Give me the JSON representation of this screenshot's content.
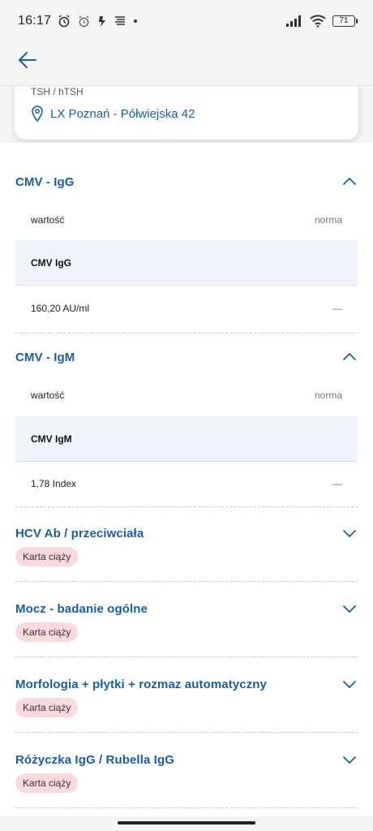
{
  "status_bar": {
    "time": "16:17",
    "battery": "71"
  },
  "card": {
    "test_name": "TSH / hTSH",
    "location": "LX Poznań - Półwiejska 42"
  },
  "sections": [
    {
      "title": "CMV - IgG",
      "header_left": "wartość",
      "header_right": "norma",
      "param": "CMV IgG",
      "value": "160,20 AU/ml",
      "norm": "—"
    },
    {
      "title": "CMV - IgM",
      "header_left": "wartość",
      "header_right": "norma",
      "param": "CMV IgM",
      "value": "1,78 Index",
      "norm": "—"
    }
  ],
  "collapsed": [
    {
      "title": "HCV Ab / przeciwciała",
      "badge": "Karta ciąży"
    },
    {
      "title": "Mocz - badanie ogólne",
      "badge": "Karta ciąży"
    },
    {
      "title": "Morfologia + płytki + rozmaz automatyczny",
      "badge": "Karta ciąży"
    },
    {
      "title": "Różyczka IgG / Rubella IgG",
      "badge": "Karta ciąży"
    }
  ],
  "colors": {
    "accent": "#1a5e9e",
    "badge_bg": "#fadadd",
    "band_bg": "#eef4f9"
  }
}
